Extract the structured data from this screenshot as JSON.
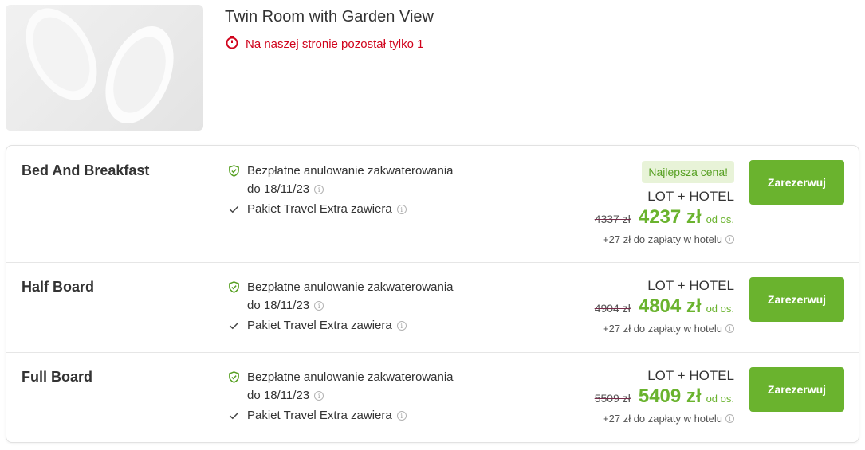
{
  "room": {
    "title": "Twin Room with Garden View",
    "availability_text": "Na naszej stronie pozostał tylko 1",
    "image_alt": "slippers-photo"
  },
  "colors": {
    "accent_green": "#6ab32e",
    "alert_red": "#d0021b",
    "best_badge_bg": "#e8f3d8"
  },
  "offers": [
    {
      "board": "Bed And Breakfast",
      "cancellation": "Bezpłatne anulowanie zakwaterowania",
      "cancellation_date": "do 18/11/23",
      "extra": "Pakiet Travel Extra zawiera",
      "badge": "Najlepsza cena!",
      "package": "LOT + HOTEL",
      "old_price": "4337 zł",
      "price": "4237 zł",
      "per_person": "od os.",
      "hotel_fee": "+27 zł do zapłaty w hotelu",
      "button": "Zarezerwuj"
    },
    {
      "board": "Half Board",
      "cancellation": "Bezpłatne anulowanie zakwaterowania",
      "cancellation_date": "do 18/11/23",
      "extra": "Pakiet Travel Extra zawiera",
      "package": "LOT + HOTEL",
      "old_price": "4904 zł",
      "price": "4804 zł",
      "per_person": "od os.",
      "hotel_fee": "+27 zł do zapłaty w hotelu",
      "button": "Zarezerwuj"
    },
    {
      "board": "Full Board",
      "cancellation": "Bezpłatne anulowanie zakwaterowania",
      "cancellation_date": "do 18/11/23",
      "extra": "Pakiet Travel Extra zawiera",
      "package": "LOT + HOTEL",
      "old_price": "5509 zł",
      "price": "5409 zł",
      "per_person": "od os.",
      "hotel_fee": "+27 zł do zapłaty w hotelu",
      "button": "Zarezerwuj"
    }
  ],
  "icons": {
    "timer": "stopwatch-icon",
    "shield": "shield-check-icon",
    "check": "checkmark-icon",
    "info": "info-icon"
  }
}
